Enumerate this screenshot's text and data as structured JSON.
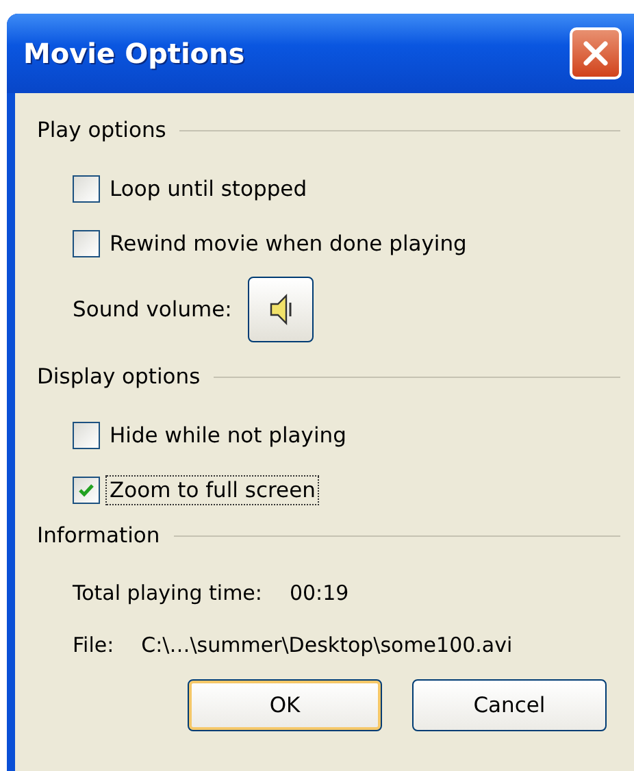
{
  "window": {
    "title": "Movie Options"
  },
  "sections": [
    {
      "heading": "Play options",
      "items": [
        {
          "kind": "checkbox",
          "label": "Loop until stopped",
          "checked": false,
          "focused": false
        },
        {
          "kind": "checkbox",
          "label": "Rewind movie when done playing",
          "checked": false,
          "focused": false
        },
        {
          "kind": "volume",
          "label": "Sound volume:"
        }
      ]
    },
    {
      "heading": "Display options",
      "items": [
        {
          "kind": "checkbox",
          "label": "Hide while not playing",
          "checked": false,
          "focused": false
        },
        {
          "kind": "checkbox",
          "label": "Zoom to full screen",
          "checked": true,
          "focused": true
        }
      ]
    },
    {
      "heading": "Information",
      "items": [
        {
          "kind": "info",
          "label": "Total playing time:",
          "value": "00:19"
        },
        {
          "kind": "info",
          "label": "File:",
          "value": "C:\\…\\summer\\Desktop\\some100.avi"
        }
      ]
    }
  ],
  "buttons": [
    {
      "label": "OK",
      "default": true
    },
    {
      "label": "Cancel",
      "default": false
    }
  ]
}
